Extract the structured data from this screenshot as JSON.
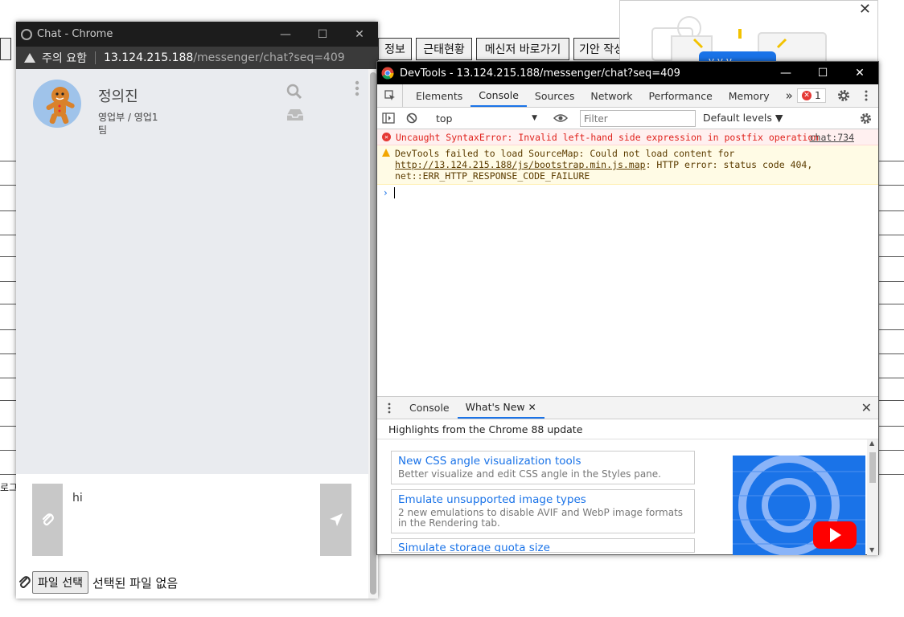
{
  "background_page": {
    "buttons": [
      "정보",
      "근태현황",
      "메신저 바로가기",
      "기안 작성"
    ],
    "side_text": "로그"
  },
  "chat_window": {
    "title": "Chat - Chrome",
    "security_warning": "주의 요함",
    "url_host": "13.124.215.188",
    "url_path": "/messenger/chat?seq=409",
    "user": {
      "name": "정의진",
      "department": "영업부 / 영업1",
      "team": "팀"
    },
    "message_value": "hi",
    "file_button": "파일 선택",
    "file_status": "선택된 파일 없음"
  },
  "devtools": {
    "title": "DevTools - 13.124.215.188/messenger/chat?seq=409",
    "tabs": [
      "Elements",
      "Console",
      "Sources",
      "Network",
      "Performance",
      "Memory"
    ],
    "more_tabs": "»",
    "error_count": "1",
    "context": "top",
    "filter_placeholder": "Filter",
    "levels": "Default levels ▼",
    "console": {
      "error_text": "Uncaught SyntaxError: Invalid left-hand side expression in postfix operation",
      "error_source": "chat:734",
      "warning_prefix": "DevTools failed to load SourceMap: Could not load content for ",
      "warning_link": "http://13.124.215.188/js/bootstrap.min.js.map",
      "warning_suffix": ": HTTP error: status code 404, net::ERR_HTTP_RESPONSE_CODE_FAILURE",
      "prompt": "›"
    },
    "drawer": {
      "tabs": [
        "Console",
        "What's New"
      ],
      "highlights": "Highlights from the Chrome 88 update",
      "items": [
        {
          "title": "New CSS angle visualization tools",
          "desc": "Better visualize and edit CSS angle in the Styles pane."
        },
        {
          "title": "Emulate unsupported image types",
          "desc": "2 new emulations to disable AVIF and WebP image formats in the Rendering tab."
        },
        {
          "title": "Simulate storage quota size",
          "desc": ""
        }
      ]
    }
  },
  "colors": {
    "accent_blue": "#1a73e8",
    "error_red": "#e0221c",
    "chat_bg": "#e9ebef",
    "youtube_red": "#ff0000"
  }
}
